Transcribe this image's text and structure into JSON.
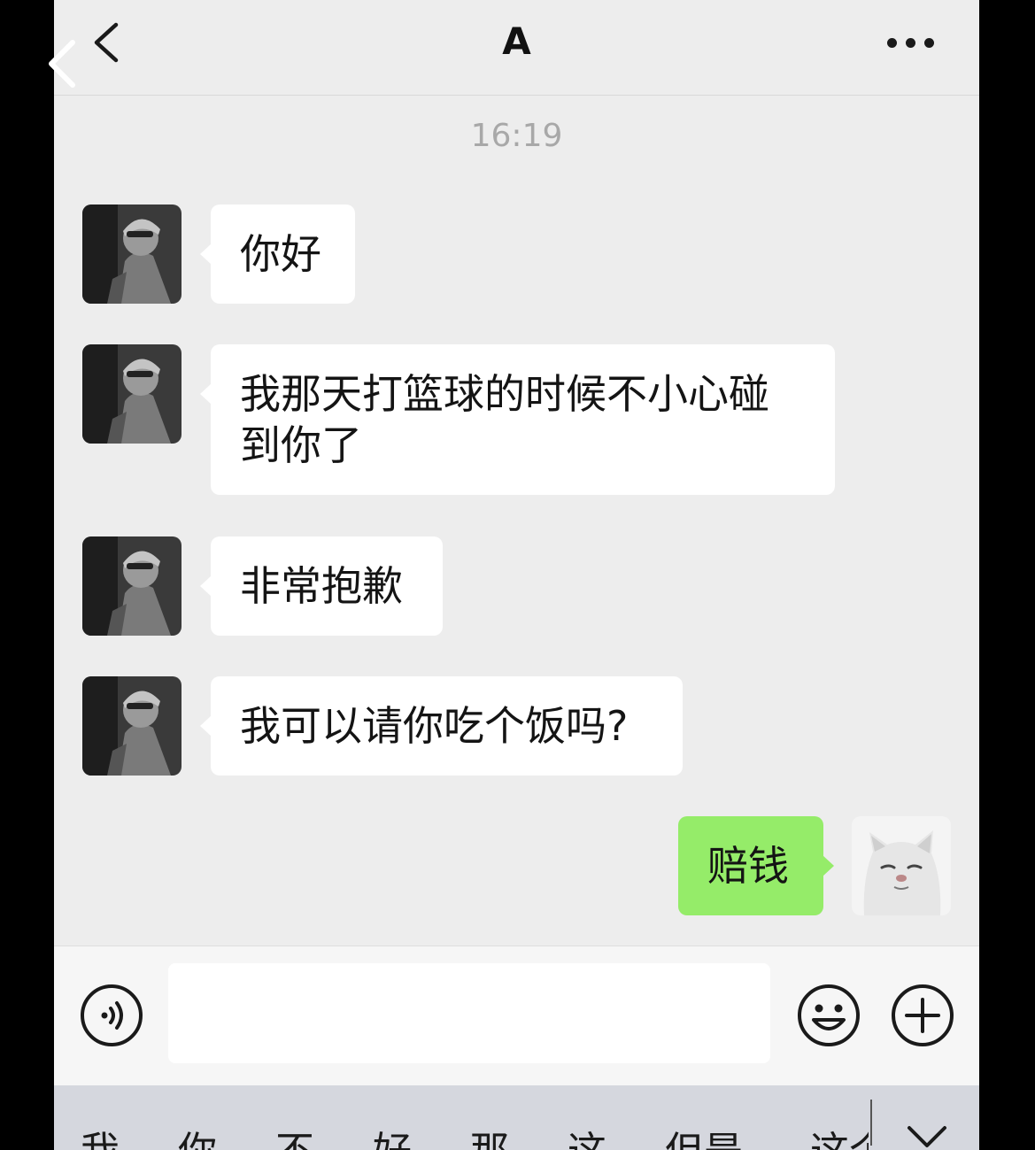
{
  "header": {
    "title": "A"
  },
  "timestamp": "16:19",
  "messages": [
    {
      "side": "left",
      "lines": [
        "你好"
      ]
    },
    {
      "side": "left",
      "lines": [
        "我那天打篮球的时候不小心碰",
        "到你了"
      ]
    },
    {
      "side": "left",
      "lines": [
        "非常抱歉"
      ]
    },
    {
      "side": "left",
      "lines": [
        "我可以请你吃个饭吗?"
      ]
    },
    {
      "side": "right",
      "lines": [
        "赔钱"
      ]
    }
  ],
  "input": {
    "value": ""
  },
  "keyboard": {
    "candidates": [
      "我",
      "你",
      "不",
      "好",
      "那",
      "这",
      "但是",
      "这个"
    ]
  },
  "colors": {
    "background": "#ededed",
    "incoming_bubble": "#ffffff",
    "outgoing_bubble": "#95ec69",
    "keyboard_bar": "#d5d7de"
  },
  "icons": {
    "back": "chevron-left-icon",
    "more": "more-dots-icon",
    "voice": "voice-icon",
    "emoji": "emoji-icon",
    "plus": "plus-icon",
    "collapse": "chevron-down-icon"
  }
}
